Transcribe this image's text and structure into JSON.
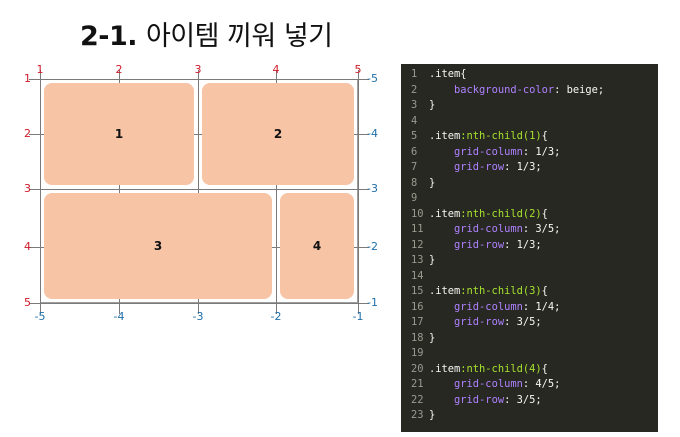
{
  "title": {
    "number": "2-1.",
    "text": "아이템 끼워 넣기"
  },
  "diagram": {
    "column_lines_positive": [
      "1",
      "2",
      "3",
      "4",
      "5"
    ],
    "column_lines_negative": [
      "-5",
      "-4",
      "-3",
      "-2",
      "-1"
    ],
    "row_lines_positive": [
      "1",
      "2",
      "3",
      "4",
      "5"
    ],
    "row_lines_negative": [
      "-5",
      "-4",
      "-3",
      "-2",
      "-1"
    ],
    "items": [
      {
        "label": "1",
        "grid_column": "1/3",
        "grid_row": "1/3"
      },
      {
        "label": "2",
        "grid_column": "3/5",
        "grid_row": "1/3"
      },
      {
        "label": "3",
        "grid_column": "1/4",
        "grid_row": "3/5"
      },
      {
        "label": "4",
        "grid_column": "4/5",
        "grid_row": "3/5"
      }
    ],
    "colors": {
      "item": "#f7c4a6",
      "positive_label": "#d11a2a",
      "negative_label": "#1f6fa8"
    }
  },
  "code": {
    "colors": {
      "background": "#272822",
      "selector": "#f8f8f2",
      "pseudo": "#a6e22e",
      "property": "#ae81ff"
    },
    "lines": [
      {
        "n": "1",
        "tokens": [
          [
            "sel",
            ".item"
          ],
          [
            "punct",
            "{"
          ]
        ]
      },
      {
        "n": "2",
        "tokens": [
          [
            "punct",
            "    "
          ],
          [
            "prop",
            "background-color"
          ],
          [
            "punct",
            ": "
          ],
          [
            "val",
            "beige;"
          ]
        ]
      },
      {
        "n": "3",
        "tokens": [
          [
            "punct",
            "}"
          ]
        ]
      },
      {
        "n": "4",
        "tokens": []
      },
      {
        "n": "5",
        "tokens": [
          [
            "sel",
            ".item"
          ],
          [
            "pseudo",
            ":nth-child(1)"
          ],
          [
            "punct",
            "{"
          ]
        ]
      },
      {
        "n": "6",
        "tokens": [
          [
            "punct",
            "    "
          ],
          [
            "prop",
            "grid-column"
          ],
          [
            "punct",
            ": "
          ],
          [
            "val",
            "1/3;"
          ]
        ]
      },
      {
        "n": "7",
        "tokens": [
          [
            "punct",
            "    "
          ],
          [
            "prop",
            "grid-row"
          ],
          [
            "punct",
            ": "
          ],
          [
            "val",
            "1/3;"
          ]
        ]
      },
      {
        "n": "8",
        "tokens": [
          [
            "punct",
            "}"
          ]
        ]
      },
      {
        "n": "9",
        "tokens": []
      },
      {
        "n": "10",
        "tokens": [
          [
            "sel",
            ".item"
          ],
          [
            "pseudo",
            ":nth-child(2)"
          ],
          [
            "punct",
            "{"
          ]
        ]
      },
      {
        "n": "11",
        "tokens": [
          [
            "punct",
            "    "
          ],
          [
            "prop",
            "grid-column"
          ],
          [
            "punct",
            ": "
          ],
          [
            "val",
            "3/5;"
          ]
        ]
      },
      {
        "n": "12",
        "tokens": [
          [
            "punct",
            "    "
          ],
          [
            "prop",
            "grid-row"
          ],
          [
            "punct",
            ": "
          ],
          [
            "val",
            "1/3;"
          ]
        ]
      },
      {
        "n": "13",
        "tokens": [
          [
            "punct",
            "}"
          ]
        ]
      },
      {
        "n": "14",
        "tokens": []
      },
      {
        "n": "15",
        "tokens": [
          [
            "sel",
            ".item"
          ],
          [
            "pseudo",
            ":nth-child(3)"
          ],
          [
            "punct",
            "{"
          ]
        ]
      },
      {
        "n": "16",
        "tokens": [
          [
            "punct",
            "    "
          ],
          [
            "prop",
            "grid-column"
          ],
          [
            "punct",
            ": "
          ],
          [
            "val",
            "1/4;"
          ]
        ]
      },
      {
        "n": "17",
        "tokens": [
          [
            "punct",
            "    "
          ],
          [
            "prop",
            "grid-row"
          ],
          [
            "punct",
            ": "
          ],
          [
            "val",
            "3/5;"
          ]
        ]
      },
      {
        "n": "18",
        "tokens": [
          [
            "punct",
            "}"
          ]
        ]
      },
      {
        "n": "19",
        "tokens": []
      },
      {
        "n": "20",
        "tokens": [
          [
            "sel",
            ".item"
          ],
          [
            "pseudo",
            ":nth-child(4)"
          ],
          [
            "punct",
            "{"
          ]
        ]
      },
      {
        "n": "21",
        "tokens": [
          [
            "punct",
            "    "
          ],
          [
            "prop",
            "grid-column"
          ],
          [
            "punct",
            ": "
          ],
          [
            "val",
            "4/5;"
          ]
        ]
      },
      {
        "n": "22",
        "tokens": [
          [
            "punct",
            "    "
          ],
          [
            "prop",
            "grid-row"
          ],
          [
            "punct",
            ": "
          ],
          [
            "val",
            "3/5;"
          ]
        ]
      },
      {
        "n": "23",
        "tokens": [
          [
            "punct",
            "}"
          ]
        ]
      }
    ]
  }
}
